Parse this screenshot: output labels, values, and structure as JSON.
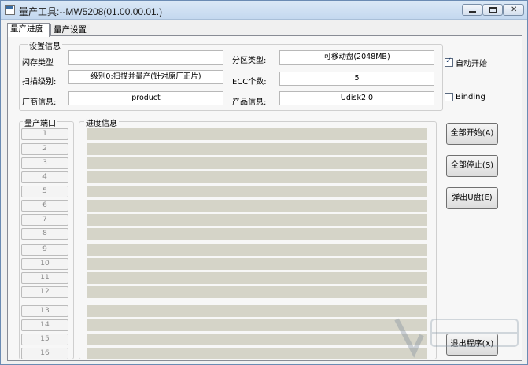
{
  "window": {
    "title": "量产工具:--MW5208(01.00.00.01.)"
  },
  "tabs": [
    {
      "label": "量产进度",
      "active": true
    },
    {
      "label": "量产设置",
      "active": false
    }
  ],
  "settings": {
    "group_caption": "设置信息",
    "flash_type_label": "闪存类型",
    "flash_type_value": "",
    "scan_level_label": "扫描级别:",
    "scan_level_value": "级别0:扫描并量产(针对原厂正片)",
    "vendor_label": "厂商信息:",
    "vendor_value": "product",
    "partition_label": "分区类型:",
    "partition_value": "可移动盘(2048MB)",
    "ecc_label": "ECC个数:",
    "ecc_value": "5",
    "product_label": "产品信息:",
    "product_value": "Udisk2.0"
  },
  "options": {
    "auto_start_label": "自动开始",
    "auto_start_checked": true,
    "binding_label": "Binding",
    "binding_checked": false
  },
  "ports": {
    "caption": "量产端口",
    "items": [
      "1",
      "2",
      "3",
      "4",
      "5",
      "6",
      "7",
      "8",
      "9",
      "10",
      "11",
      "12",
      "13",
      "14",
      "15",
      "16"
    ]
  },
  "progress": {
    "caption": "进度信息"
  },
  "buttons": {
    "start_all": "全部开始(A)",
    "stop_all": "全部停止(S)",
    "eject": "弹出U盘(E)",
    "exit": "退出程序(X)"
  },
  "colors": {
    "title_bar": "#c4d8ef",
    "progress_bar": "#d5d4c8",
    "panel": "#f7f7f7"
  }
}
